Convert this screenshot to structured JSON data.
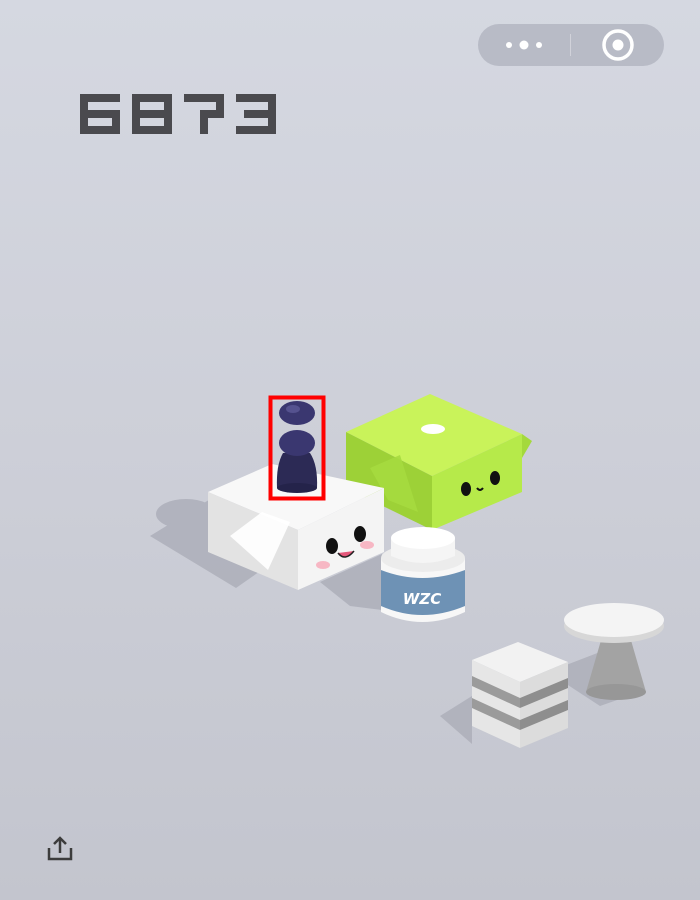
{
  "score": "6873",
  "capsule": {
    "more_icon": "more-dots-icon",
    "close_icon": "target-close-icon"
  },
  "share": {
    "icon": "share-upload-icon"
  },
  "bottle": {
    "label": "WZC"
  },
  "colors": {
    "background_top": "#d5d8e1",
    "background_bottom": "#c3c5ce",
    "score": "#4a4a4e",
    "player_piece": "#2c2a55",
    "green_box": "#b6ea4a",
    "white_box": "#f3f3f3",
    "bottle_label": "#6e92b5",
    "selection_box": "#ff0000"
  }
}
